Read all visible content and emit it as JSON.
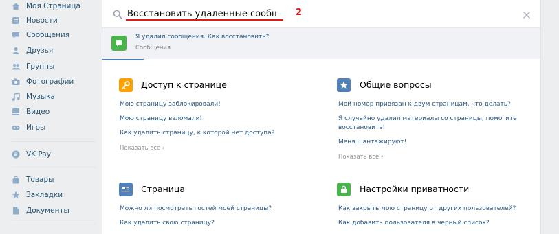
{
  "sidebar": {
    "items": [
      {
        "label": "Моя Страница",
        "icon": "home-icon"
      },
      {
        "label": "Новости",
        "icon": "news-icon"
      },
      {
        "label": "Сообщения",
        "icon": "messages-icon"
      },
      {
        "label": "Друзья",
        "icon": "friend-icon"
      },
      {
        "label": "Группы",
        "icon": "groups-icon"
      },
      {
        "label": "Фотографии",
        "icon": "camera-icon"
      },
      {
        "label": "Музыка",
        "icon": "music-icon"
      },
      {
        "label": "Видео",
        "icon": "video-icon"
      },
      {
        "label": "Игры",
        "icon": "gamepad-icon"
      },
      {
        "label": "VK Pay",
        "icon": "vkpay-icon"
      },
      {
        "label": "Товары",
        "icon": "bag-icon"
      },
      {
        "label": "Закладки",
        "icon": "star-icon"
      },
      {
        "label": "Документы",
        "icon": "document-icon"
      }
    ]
  },
  "search": {
    "value": "Восстановить удаленные сообщения",
    "annotation": "2"
  },
  "suggestion": {
    "title": "Я удалил сообщения. Как восстановить?",
    "subtitle": "Сообщения"
  },
  "sections": {
    "access": {
      "title": "Доступ к странице",
      "links": [
        "Мою страницу заблокировали!",
        "Мою страницу взломали!",
        "Как удалить страницу, к которой нет доступа?"
      ],
      "more": "Показать все"
    },
    "general": {
      "title": "Общие вопросы",
      "links": [
        "Мой номер привязан к двум страницам, что делать?",
        "Я случайно удалил материалы со страницы, помогите",
        "восстановить!",
        "Меня шантажируют!"
      ],
      "more": "Показать все"
    },
    "page": {
      "title": "Страница",
      "links": [
        "Можно ли посмотреть гостей моей страницы?",
        "Как удалить свою страницу?"
      ]
    },
    "privacy": {
      "title": "Настройки приватности",
      "links": [
        "Как закрыть мою страницу от других пользователей?",
        "Как добавить пользователя в черный список?"
      ]
    }
  },
  "colors": {
    "link": "#2a5885",
    "access_icon": "#ffa000",
    "general_icon": "#5181b8",
    "page_icon": "#5181b8",
    "privacy_icon": "#4bb34b",
    "annotation": "#e01818"
  }
}
